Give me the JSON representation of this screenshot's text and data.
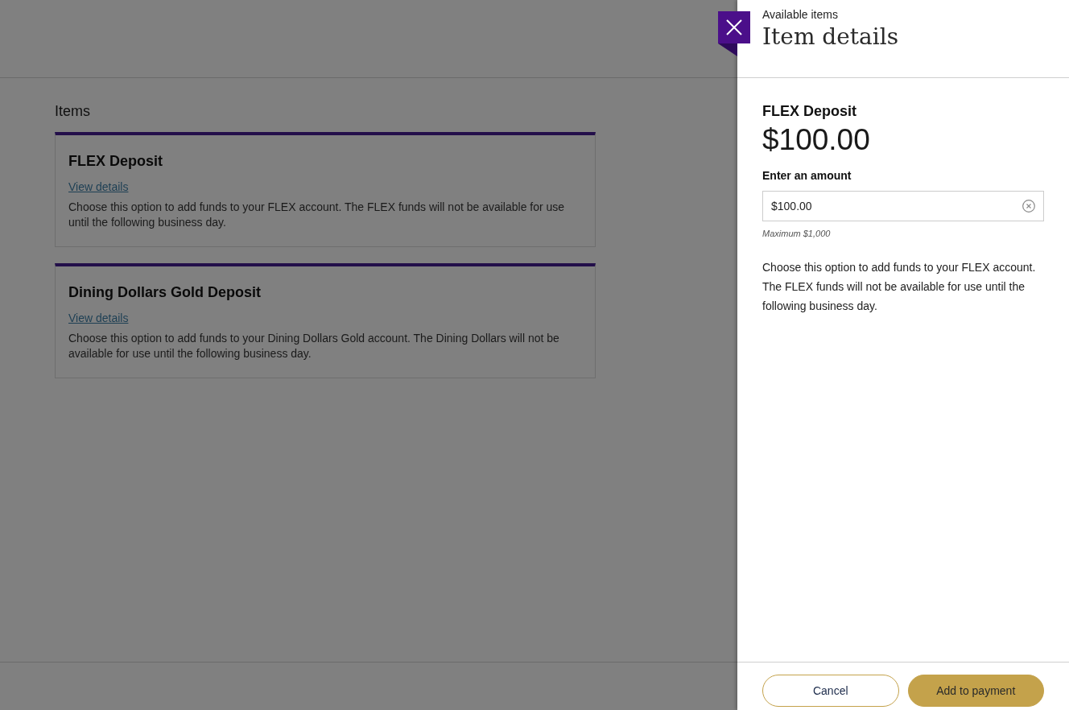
{
  "page": {
    "heading": "Items",
    "items": [
      {
        "title": "FLEX Deposit",
        "link": "View details",
        "description": "Choose this option to add funds to your FLEX account. The FLEX funds will not be available for use until the following business day."
      },
      {
        "title": "Dining Dollars Gold Deposit",
        "link": "View details",
        "description": "Choose this option to add funds to your Dining Dollars Gold account. The Dining Dollars will not be available for use until the following business day."
      }
    ]
  },
  "panel": {
    "breadcrumb": "Available items",
    "title": "Item details",
    "item_name": "FLEX Deposit",
    "price": "$100.00",
    "amount_field": {
      "label": "Enter an amount",
      "value": "$100.00",
      "hint": "Maximum $1,000"
    },
    "description": "Choose this option to add funds to your FLEX account. The FLEX funds will not be available for use until the following business day.",
    "buttons": [
      {
        "label": "Cancel",
        "kind": "secondary"
      },
      {
        "label": "Add to payment",
        "kind": "primary"
      }
    ]
  }
}
